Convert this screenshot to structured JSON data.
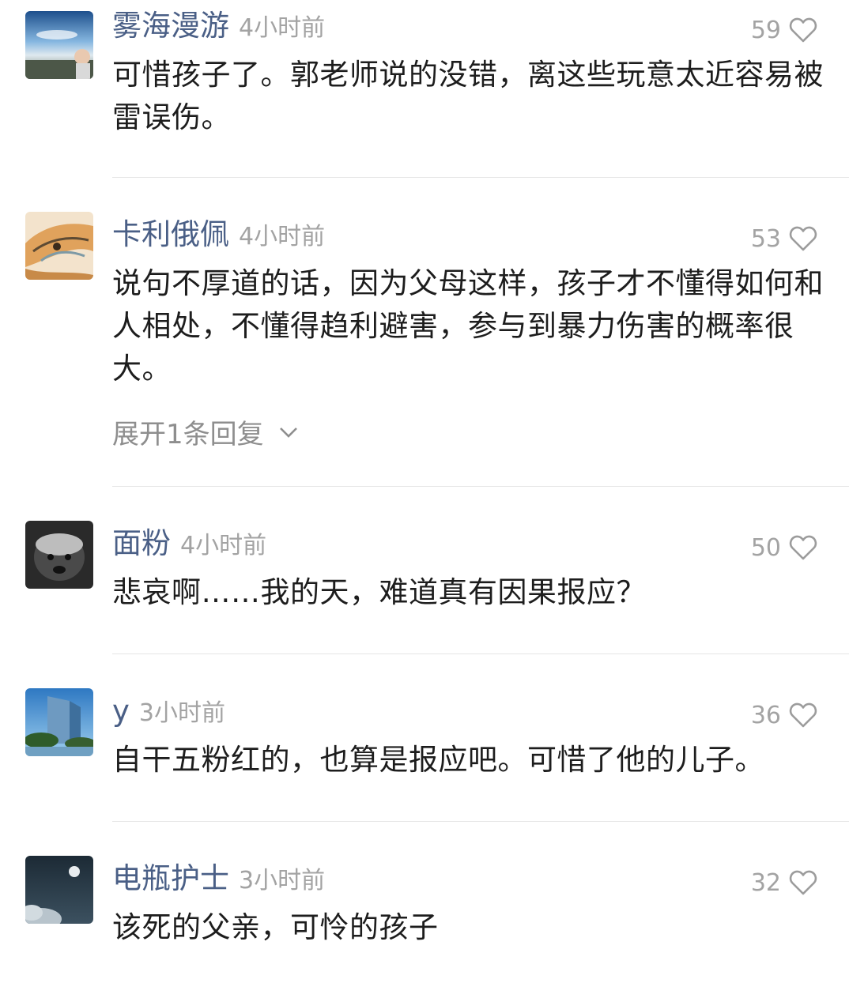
{
  "comments": [
    {
      "name": "雾海漫游",
      "time": "4小时前",
      "likes": "59",
      "text": "可惜孩子了。郭老师说的没错，离这些玩意太近容易被雷误伤。",
      "avatar_icon": "sky-portrait-avatar"
    },
    {
      "name": "卡利俄佩",
      "time": "4小时前",
      "likes": "53",
      "text": "说句不厚道的话，因为父母这样，孩子才不懂得如何和人相处，不懂得趋利避害，参与到暴力伤害的概率很大。",
      "reply_toggle": "展开1条回复",
      "avatar_icon": "fox-art-avatar"
    },
    {
      "name": "面粉",
      "time": "4小时前",
      "likes": "50",
      "text": "悲哀啊……我的天，难道真有因果报应？",
      "avatar_icon": "badger-avatar"
    },
    {
      "name": "y",
      "time": "3小时前",
      "likes": "36",
      "text": "自干五粉红的，也算是报应吧。可惜了他的儿子。",
      "avatar_icon": "building-avatar"
    },
    {
      "name": "电瓶护士",
      "time": "3小时前",
      "likes": "32",
      "text": "该死的父亲，可怜的孩子",
      "avatar_icon": "moon-night-avatar"
    }
  ],
  "colors": {
    "name": "#4a5f86",
    "meta": "#a3a3a3",
    "text": "#1d1d1d",
    "divider": "#e6e6e6"
  }
}
